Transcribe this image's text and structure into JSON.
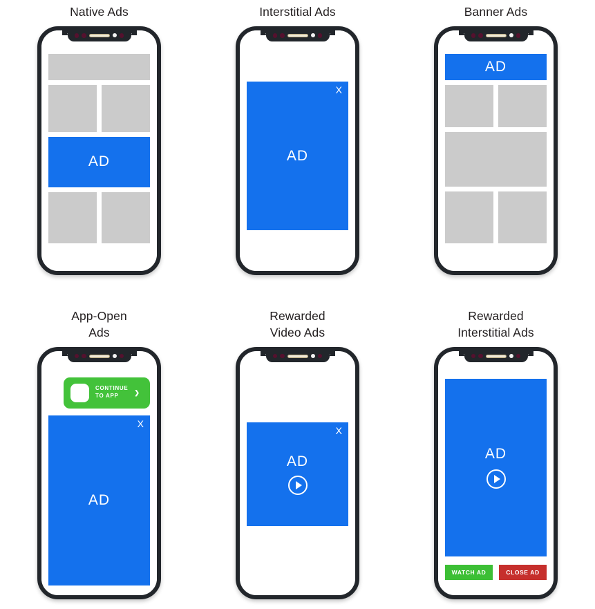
{
  "colors": {
    "ad_blue": "#1471ed",
    "placeholder_gray": "#cbcbcb",
    "green": "#43c23a",
    "red": "#c62f2c",
    "frame": "#22262b",
    "notch_dot": "#55112e"
  },
  "cards": [
    {
      "title": "Native Ads",
      "ad_label": "AD",
      "icons": []
    },
    {
      "title": "Interstitial Ads",
      "ad_label": "AD",
      "close_label": "X",
      "icons": [
        "close-x-icon"
      ]
    },
    {
      "title": "Banner Ads",
      "ad_label": "AD",
      "icons": []
    },
    {
      "title": "App-Open\nAds",
      "ad_label": "AD",
      "close_label": "X",
      "cta_line1": "CONTINUE",
      "cta_line2": "TO APP",
      "cta_chevron": "❯",
      "icons": [
        "app-icon",
        "chevron-right-icon",
        "close-x-icon"
      ]
    },
    {
      "title": "Rewarded\nVideo Ads",
      "ad_label": "AD",
      "close_label": "X",
      "icons": [
        "play-icon",
        "close-x-icon"
      ]
    },
    {
      "title": "Rewarded\nInterstitial Ads",
      "ad_label": "AD",
      "watch_label": "WATCH AD",
      "close_label": "CLOSE AD",
      "icons": [
        "play-icon"
      ]
    }
  ]
}
